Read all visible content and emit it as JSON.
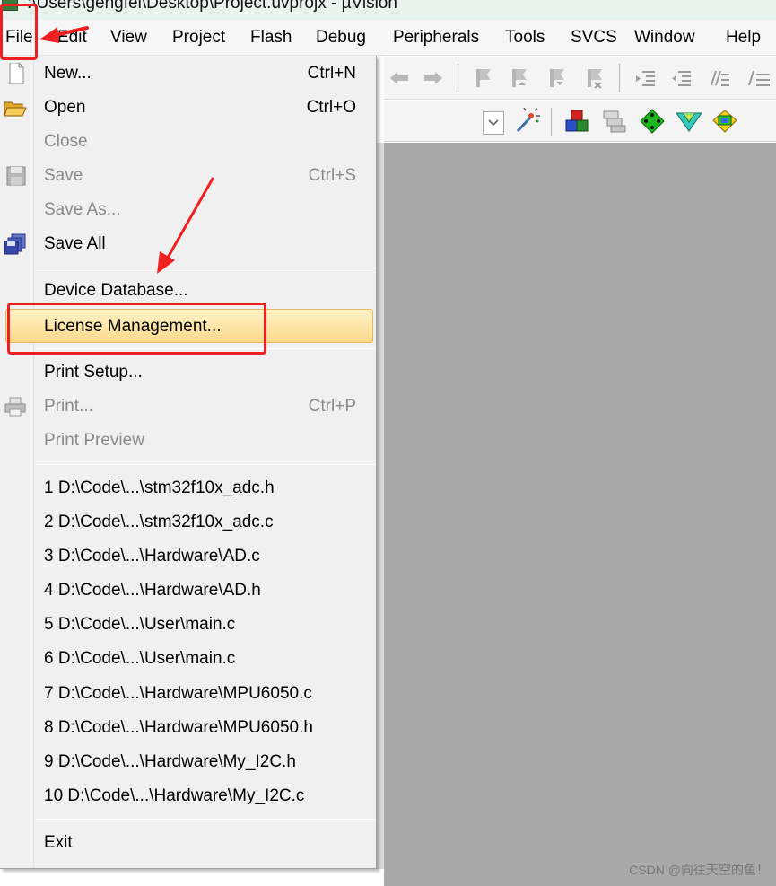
{
  "window": {
    "title": ":\\Users\\gengfei\\Desktop\\Project.uvprojx - µVision"
  },
  "menubar": {
    "file": "File",
    "edit": "Edit",
    "view": "View",
    "project": "Project",
    "flash": "Flash",
    "debug": "Debug",
    "peripherals": "Peripherals",
    "tools": "Tools",
    "svcs": "SVCS",
    "window": "Window",
    "help": "Help"
  },
  "file_menu": {
    "new": {
      "label": "New...",
      "shortcut": "Ctrl+N"
    },
    "open": {
      "label": "Open",
      "shortcut": "Ctrl+O"
    },
    "close": {
      "label": "Close"
    },
    "save": {
      "label": "Save",
      "shortcut": "Ctrl+S"
    },
    "save_as": {
      "label": "Save As..."
    },
    "save_all": {
      "label": "Save All"
    },
    "device_database": {
      "label": "Device Database..."
    },
    "license_management": {
      "label": "License Management..."
    },
    "print_setup": {
      "label": "Print Setup..."
    },
    "print": {
      "label": "Print...",
      "shortcut": "Ctrl+P"
    },
    "print_preview": {
      "label": "Print Preview"
    },
    "recent_files": [
      "1 D:\\Code\\...\\stm32f10x_adc.h",
      "2 D:\\Code\\...\\stm32f10x_adc.c",
      "3 D:\\Code\\...\\Hardware\\AD.c",
      "4 D:\\Code\\...\\Hardware\\AD.h",
      "5 D:\\Code\\...\\User\\main.c",
      "6 D:\\Code\\...\\User\\main.c",
      "7 D:\\Code\\...\\Hardware\\MPU6050.c",
      "8 D:\\Code\\...\\Hardware\\MPU6050.h",
      "9 D:\\Code\\...\\Hardware\\My_I2C.h",
      "10 D:\\Code\\...\\Hardware\\My_I2C.c"
    ],
    "exit": {
      "label": "Exit"
    }
  },
  "watermark": "CSDN @向往天空的鱼！",
  "colors": {
    "highlight_top": "#fff3c8",
    "highlight_bottom": "#fcd98a",
    "annotation_red": "#f02020",
    "workspace_gray": "#a9a9a9",
    "disabled_text": "#8a8a8a"
  }
}
